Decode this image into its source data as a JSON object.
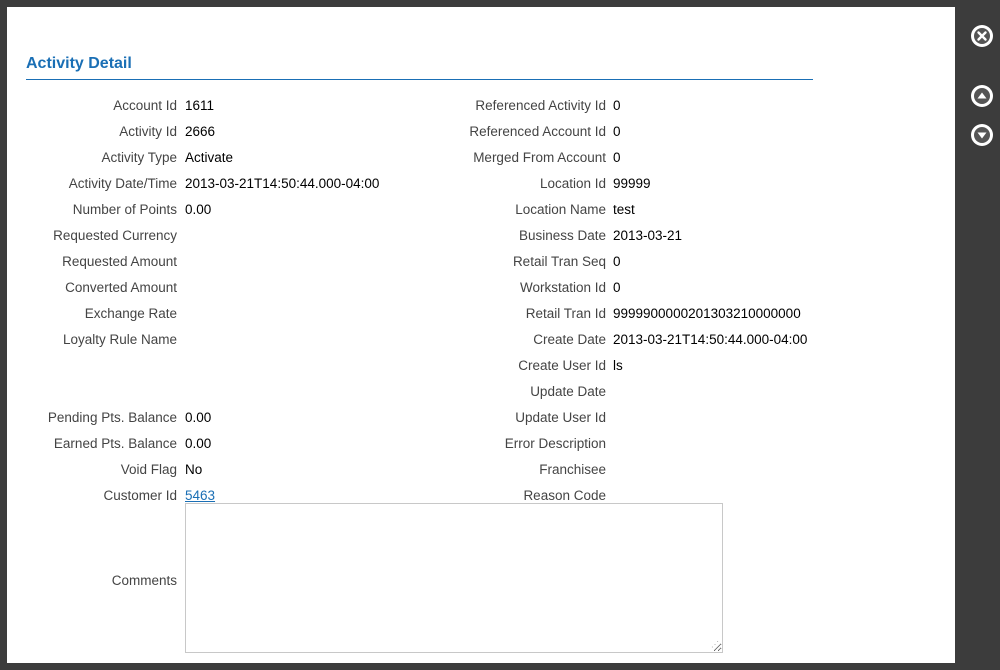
{
  "title": "Activity Detail",
  "left_fields": [
    {
      "label": "Account Id",
      "value": "1611"
    },
    {
      "label": "Activity Id",
      "value": "2666"
    },
    {
      "label": "Activity Type",
      "value": "Activate"
    },
    {
      "label": "Activity Date/Time",
      "value": "2013-03-21T14:50:44.000-04:00"
    },
    {
      "label": "Number of Points",
      "value": "0.00"
    },
    {
      "label": "Requested Currency",
      "value": ""
    },
    {
      "label": "Requested Amount",
      "value": ""
    },
    {
      "label": "Converted Amount",
      "value": ""
    },
    {
      "label": "Exchange Rate",
      "value": ""
    },
    {
      "label": "Loyalty Rule Name",
      "value": ""
    },
    {
      "label": "Pending Pts. Balance",
      "value": "0.00"
    },
    {
      "label": "Earned Pts. Balance",
      "value": "0.00"
    },
    {
      "label": "Void Flag",
      "value": "No"
    },
    {
      "label": "Customer Id",
      "value": "5463"
    },
    {
      "label": "Comments",
      "value": ""
    }
  ],
  "right_fields": [
    {
      "label": "Referenced Activity Id",
      "value": "0"
    },
    {
      "label": "Referenced Account Id",
      "value": "0"
    },
    {
      "label": "Merged From Account",
      "value": "0"
    },
    {
      "label": "Location Id",
      "value": "99999"
    },
    {
      "label": "Location Name",
      "value": "test"
    },
    {
      "label": "Business Date",
      "value": "2013-03-21"
    },
    {
      "label": "Retail Tran Seq",
      "value": "0"
    },
    {
      "label": "Workstation Id",
      "value": "0"
    },
    {
      "label": "Retail Tran Id",
      "value": "9999900000201303210000000"
    },
    {
      "label": "Create Date",
      "value": "2013-03-21T14:50:44.000-04:00"
    },
    {
      "label": "Create User Id",
      "value": "ls"
    },
    {
      "label": "Update Date",
      "value": ""
    },
    {
      "label": "Update User Id",
      "value": ""
    },
    {
      "label": "Error Description",
      "value": ""
    },
    {
      "label": "Franchisee",
      "value": ""
    },
    {
      "label": "Reason Code",
      "value": ""
    }
  ],
  "icons": {
    "close": "close-circle-icon",
    "up": "arrow-up-circle-icon",
    "down": "arrow-down-circle-icon"
  },
  "colors": {
    "accent": "#1a6fb5",
    "background": "#3c3c3c",
    "panel": "#ffffff"
  }
}
